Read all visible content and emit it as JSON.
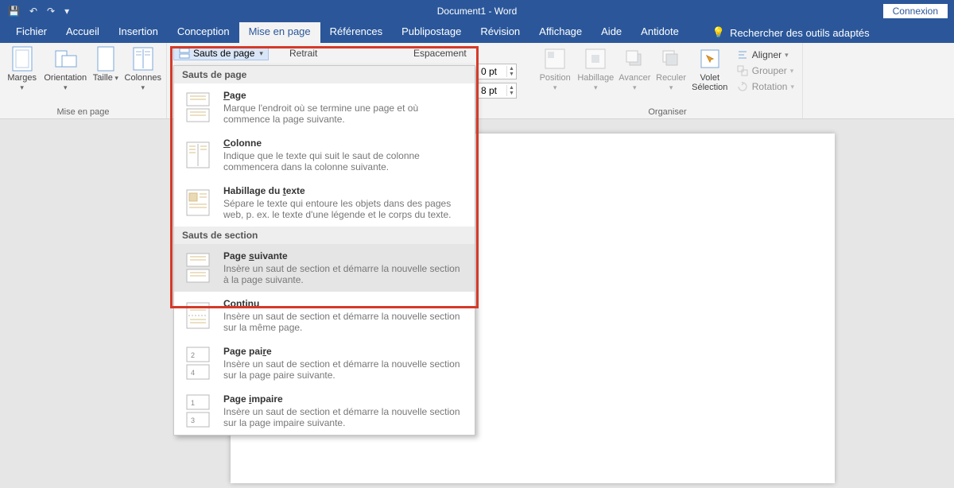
{
  "app": {
    "title": "Document1 - Word",
    "signin": "Connexion"
  },
  "qat": {
    "save": "💾",
    "undo": "↶",
    "redo": "↷",
    "custom": "▾"
  },
  "tabs": {
    "items": [
      "Fichier",
      "Accueil",
      "Insertion",
      "Conception",
      "Mise en page",
      "Références",
      "Publipostage",
      "Révision",
      "Affichage",
      "Aide",
      "Antidote"
    ],
    "active_index": 4,
    "search_hint": "Rechercher des outils adaptés"
  },
  "ribbon": {
    "group_page_setup": {
      "label": "Mise en page",
      "margins": "Marges",
      "orientation": "Orientation",
      "size": "Taille",
      "columns": "Colonnes"
    },
    "breaks_btn": "Sauts de page",
    "retrait": "Retrait",
    "espacement": "Espacement",
    "spacing_before": "0 pt",
    "spacing_after": "8 pt",
    "group_arrange": {
      "label": "Organiser",
      "position": "Position",
      "wrap": "Habillage",
      "forward": "Avancer",
      "backward": "Reculer",
      "selection_pane_l1": "Volet",
      "selection_pane_l2": "Sélection",
      "align": "Aligner",
      "group": "Grouper",
      "rotate": "Rotation"
    }
  },
  "dropdown": {
    "section1": "Sauts de page",
    "items1": [
      {
        "title_pre": "",
        "title_ul": "P",
        "title_post": "age",
        "desc": "Marque l'endroit où se termine une page et où commence la page suivante."
      },
      {
        "title_pre": "",
        "title_ul": "C",
        "title_post": "olonne",
        "desc": "Indique que le texte qui suit le saut de colonne commencera dans la colonne suivante."
      },
      {
        "title_pre": "Habillage du ",
        "title_ul": "t",
        "title_post": "exte",
        "desc": "Sépare le texte qui entoure les objets dans des pages web, p. ex. le texte d'une légende et le corps du texte."
      }
    ],
    "section2": "Sauts de section",
    "items2": [
      {
        "title_pre": "Page ",
        "title_ul": "s",
        "title_post": "uivante",
        "desc": "Insère un saut de section et démarre la nouvelle section à la page suivante."
      },
      {
        "title_pre": "Contin",
        "title_ul": "u",
        "title_post": "",
        "desc": "Insère un saut de section et démarre la nouvelle section sur la même page."
      },
      {
        "title_pre": "Page pai",
        "title_ul": "r",
        "title_post": "e",
        "desc": "Insère un saut de section et démarre la nouvelle section sur la page paire suivante."
      },
      {
        "title_pre": "Page ",
        "title_ul": "i",
        "title_post": "mpaire",
        "desc": "Insère un saut de section et démarre la nouvelle section sur la page impaire suivante."
      }
    ],
    "hover_index": 0
  }
}
